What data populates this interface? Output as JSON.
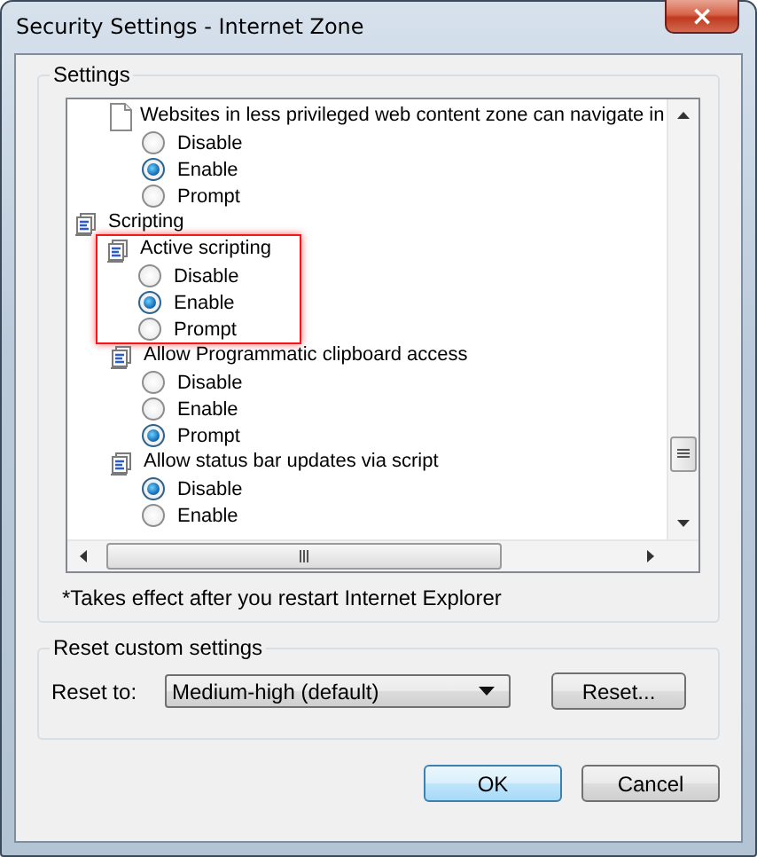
{
  "window": {
    "title": "Security Settings - Internet Zone",
    "close_label": "×"
  },
  "settings_group": {
    "label": "Settings",
    "items": [
      {
        "kind": "plain",
        "label": "Websites in less privileged web content zone can navigate in",
        "highlighted": false,
        "options": [
          {
            "label": "Disable",
            "selected": false
          },
          {
            "label": "Enable",
            "selected": true
          },
          {
            "label": "Prompt",
            "selected": false
          }
        ]
      },
      {
        "kind": "group",
        "label": "Scripting",
        "children": [
          {
            "kind": "script",
            "label": "Active scripting",
            "highlighted": true,
            "options": [
              {
                "label": "Disable",
                "selected": false
              },
              {
                "label": "Enable",
                "selected": true
              },
              {
                "label": "Prompt",
                "selected": false
              }
            ]
          },
          {
            "kind": "script",
            "label": "Allow Programmatic clipboard access",
            "highlighted": false,
            "options": [
              {
                "label": "Disable",
                "selected": false
              },
              {
                "label": "Enable",
                "selected": false
              },
              {
                "label": "Prompt",
                "selected": true
              }
            ]
          },
          {
            "kind": "script",
            "label": "Allow status bar updates via script",
            "highlighted": false,
            "options": [
              {
                "label": "Disable",
                "selected": true
              },
              {
                "label": "Enable",
                "selected": false
              }
            ]
          }
        ]
      }
    ],
    "note": "*Takes effect after you restart Internet Explorer"
  },
  "reset_group": {
    "label": "Reset custom settings",
    "reset_to_label": "Reset to:",
    "reset_to_value": "Medium-high (default)",
    "reset_button": "Reset..."
  },
  "buttons": [
    {
      "label": "OK",
      "default": true
    },
    {
      "label": "Cancel",
      "default": false
    }
  ]
}
